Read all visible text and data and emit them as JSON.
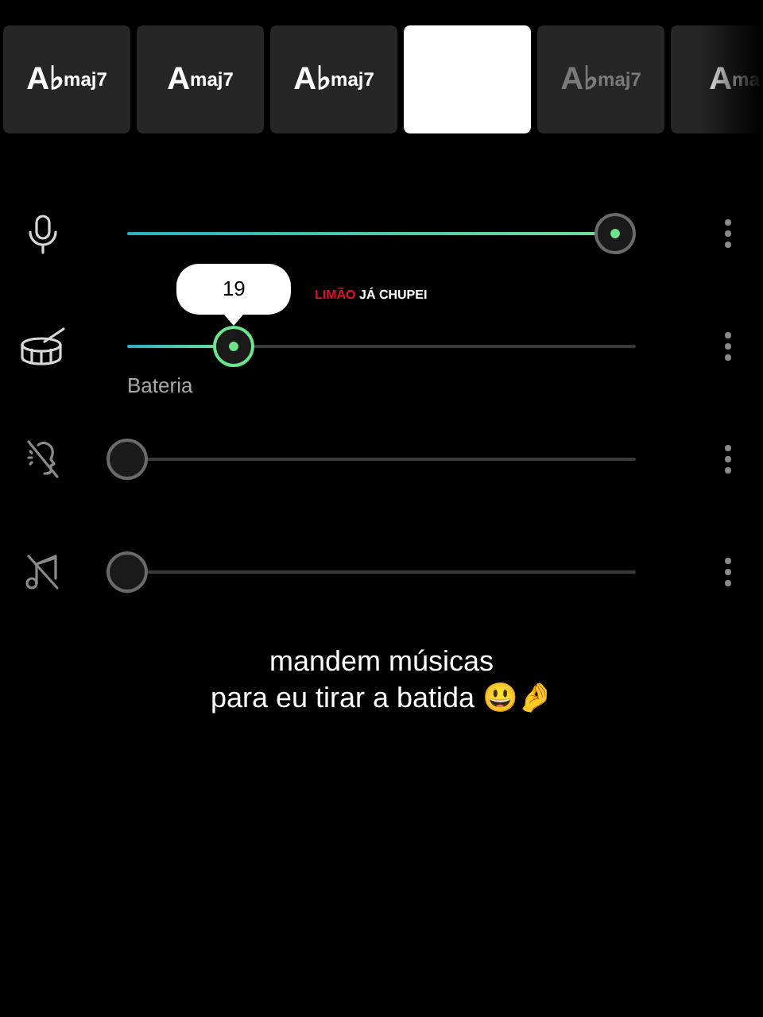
{
  "chords": [
    {
      "root": "A♭",
      "suffix": "maj7",
      "selected": false,
      "dimmed": false
    },
    {
      "root": "A",
      "suffix": "maj7",
      "selected": false,
      "dimmed": false
    },
    {
      "root": "A♭",
      "suffix": "maj7",
      "selected": false,
      "dimmed": false
    },
    {
      "selected": true,
      "dimmed": false
    },
    {
      "root": "A♭",
      "suffix": "maj7",
      "selected": false,
      "dimmed": true
    },
    {
      "root": "A",
      "suffix": "ma",
      "selected": false,
      "dimmed": false
    }
  ],
  "tracks": [
    {
      "kind": "mic",
      "muted": false,
      "level": 0.96
    },
    {
      "kind": "drum",
      "muted": false,
      "level": 0.21,
      "tooltip": "19",
      "label": "Bateria"
    },
    {
      "kind": "muted-voice",
      "muted": true,
      "level": 0
    },
    {
      "kind": "muted-music",
      "muted": true,
      "level": 0
    }
  ],
  "overlay": {
    "red": "LIMÃO",
    "white": "JÁ CHUPEI"
  },
  "caption": [
    "mandem músicas",
    "para eu tirar a batida 😃🤌"
  ]
}
